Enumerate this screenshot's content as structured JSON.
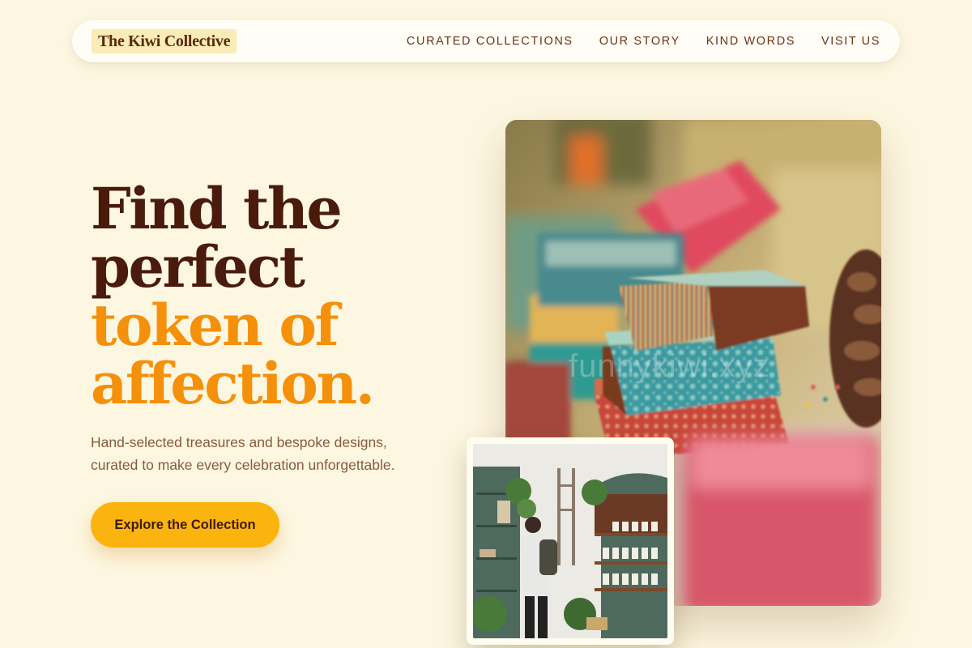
{
  "brand": {
    "name": "The Kiwi Collective"
  },
  "nav": {
    "links": [
      "CURATED COLLECTIONS",
      "OUR STORY",
      "KIND WORDS",
      "VISIT US"
    ]
  },
  "hero": {
    "headline": {
      "line1": "Find the",
      "line2": "perfect",
      "accent1": "token of",
      "accent2": "affection."
    },
    "subtext": {
      "line1": "Hand-selected treasures and bespoke designs,",
      "line2": "curated to make every celebration unforgettable."
    },
    "cta_label": "Explore the Collection"
  },
  "images": {
    "main": {
      "subject": "blurred stack of colorful wrapped gift boxes with a pine cone",
      "watermark": "funnykiwi.xyz"
    },
    "secondary": {
      "subject": "person browsing shelves in a plant-filled gift shop"
    }
  },
  "colors": {
    "background": "#fdf7e1",
    "headline": "#4a1a0c",
    "accent": "#f5900a",
    "button": "#fbb40d",
    "nav_text": "#6e3418"
  }
}
